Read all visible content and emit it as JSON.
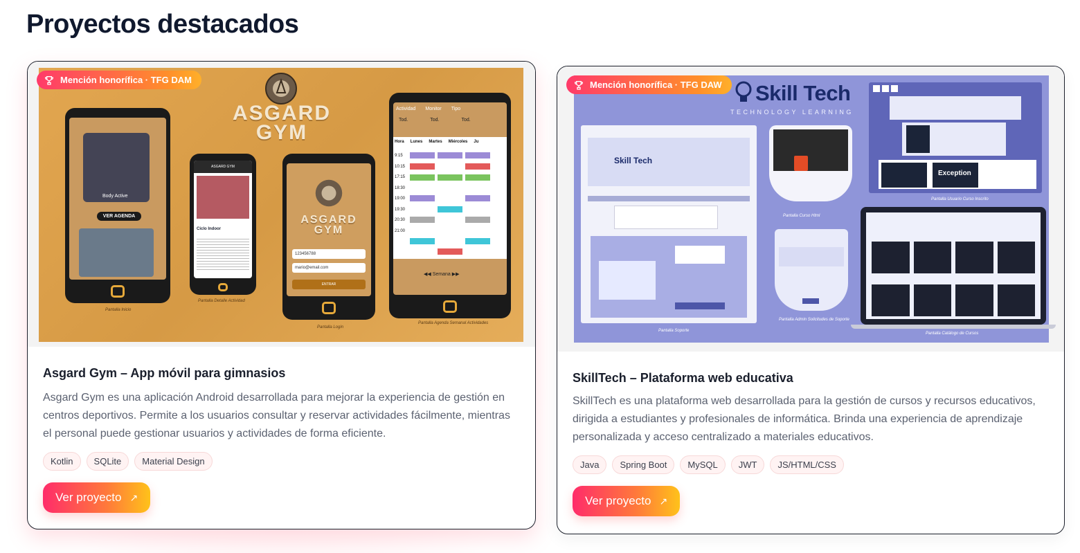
{
  "section": {
    "title": "Proyectos destacados"
  },
  "projects": [
    {
      "badge": "Mención honorífica · TFG DAM",
      "image_alt": "Asgard Gym",
      "title": "Asgard Gym – App móvil para gimnasios",
      "description": "Asgard Gym es una aplicación Android desarrollada para mejorar la experiencia de gestión en centros deportivos. Permite a los usuarios consultar y reservar actividades fácilmente, mientras el personal puede gestionar usuarios y actividades de forma eficiente.",
      "tags": [
        "Kotlin",
        "SQLite",
        "Material Design"
      ],
      "button": "Ver proyecto",
      "art": {
        "logo": "ASGARD GYM",
        "small_logo": "ASGARD GYM",
        "ver_agenda": "VER AGENDA",
        "body_active": "Body Active",
        "ciclo_indoor": "Ciclo Indoor",
        "login_user": "123456788",
        "login_email": "mario@email.com",
        "entrar": "ENTRAR",
        "semana": "Semana",
        "filters": [
          "Actividad",
          "Monitor",
          "Tipo"
        ],
        "filter_values": [
          "Tod.",
          "Tod.",
          "Tod."
        ],
        "days": [
          "Hora",
          "Lunes",
          "Martes",
          "Miércoles",
          "Ju"
        ],
        "hours": [
          "9:15",
          "10:15",
          "17:15",
          "18:30",
          "19:00",
          "19:30",
          "20:30",
          "21:00"
        ],
        "captions": [
          "Pantalla Inicio",
          "Pantalla Detalle Actividad",
          "Pantalla Login",
          "Pantalla Agenda Semanal Actividades"
        ]
      }
    },
    {
      "badge": "Mención honorífica · TFG DAW",
      "image_alt": "SkillTech",
      "title": "SkillTech – Plataforma web educativa",
      "description": "SkillTech es una plataforma web desarrollada para la gestión de cursos y recursos educativos, dirigida a estudiantes y profesionales de informática. Brinda una experiencia de aprendizaje personalizada y acceso centralizado a materiales educativos.",
      "tags": [
        "Java",
        "Spring Boot",
        "MySQL",
        "JWT",
        "JS/HTML/CSS"
      ],
      "button": "Ver proyecto",
      "art": {
        "logo": "Skill Tech",
        "tagline": "TECHNOLOGY LEARNING",
        "small_logo": "Skill Tech",
        "exception": "Exception",
        "captions": [
          "Pantalla Soporte",
          "Pantalla Curso Html",
          "Pantalla Admin Solicitudes de Soporte",
          "Pantalla Catálogo de Cursos",
          "Pantalla Usuario Curso Inscrito"
        ]
      }
    }
  ],
  "colors": {
    "accent_start": "#ff2c6a",
    "accent_end": "#ffc21a",
    "heading": "#10192e"
  },
  "icons": {
    "badge": "trophy-icon",
    "button": "arrow-up-right-icon"
  }
}
